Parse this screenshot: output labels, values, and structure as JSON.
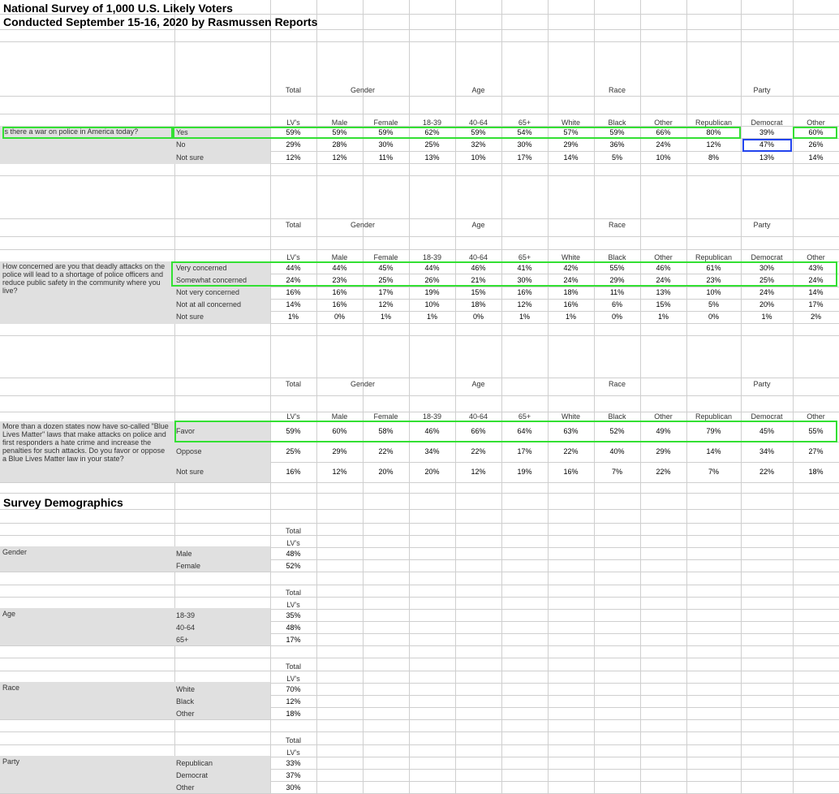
{
  "title_line1": "National Survey of 1,000 U.S. Likely Voters",
  "title_line2": "Conducted September 15-16, 2020 by Rasmussen Reports",
  "group_labels": [
    "Total",
    "Gender",
    "Age",
    "Race",
    "Party"
  ],
  "col_labels": [
    "LV's",
    "Male",
    "Female",
    "18-39",
    "40-64",
    "65+",
    "White",
    "Black",
    "Other",
    "Republican",
    "Democrat",
    "Other"
  ],
  "questions": [
    {
      "text": "Is there a war on police in America today?",
      "answers": [
        "Yes",
        "No",
        "Not sure"
      ],
      "rows": [
        [
          "59%",
          "59%",
          "59%",
          "62%",
          "59%",
          "54%",
          "57%",
          "59%",
          "66%",
          "80%",
          "39%",
          "60%"
        ],
        [
          "29%",
          "28%",
          "30%",
          "25%",
          "32%",
          "30%",
          "29%",
          "36%",
          "24%",
          "12%",
          "47%",
          "26%"
        ],
        [
          "12%",
          "12%",
          "11%",
          "13%",
          "10%",
          "17%",
          "14%",
          "5%",
          "10%",
          "8%",
          "13%",
          "14%"
        ]
      ]
    },
    {
      "text": "How concerned are you that deadly attacks on the police will lead to a shortage of police officers and reduce public safety in the community where you live?",
      "answers": [
        "Very concerned",
        "Somewhat concerned",
        "Not very concerned",
        "Not at all concerned",
        "Not sure"
      ],
      "rows": [
        [
          "44%",
          "44%",
          "45%",
          "44%",
          "46%",
          "41%",
          "42%",
          "55%",
          "46%",
          "61%",
          "30%",
          "43%"
        ],
        [
          "24%",
          "23%",
          "25%",
          "26%",
          "21%",
          "30%",
          "24%",
          "29%",
          "24%",
          "23%",
          "25%",
          "24%"
        ],
        [
          "16%",
          "16%",
          "17%",
          "19%",
          "15%",
          "16%",
          "18%",
          "11%",
          "13%",
          "10%",
          "24%",
          "14%"
        ],
        [
          "14%",
          "16%",
          "12%",
          "10%",
          "18%",
          "12%",
          "16%",
          "6%",
          "15%",
          "5%",
          "20%",
          "17%"
        ],
        [
          "1%",
          "0%",
          "1%",
          "1%",
          "0%",
          "1%",
          "1%",
          "0%",
          "1%",
          "0%",
          "1%",
          "2%"
        ]
      ]
    },
    {
      "text": "More than a dozen states now have so-called \"Blue Lives Matter\" laws that make attacks on police and first responders a hate crime and increase the penalties for such attacks. Do you favor or oppose a Blue Lives Matter law in your state?",
      "answers": [
        "Favor",
        "Oppose",
        "Not sure"
      ],
      "rows": [
        [
          "59%",
          "60%",
          "58%",
          "46%",
          "66%",
          "64%",
          "63%",
          "52%",
          "49%",
          "79%",
          "45%",
          "55%"
        ],
        [
          "25%",
          "29%",
          "22%",
          "34%",
          "22%",
          "17%",
          "22%",
          "40%",
          "29%",
          "14%",
          "34%",
          "27%"
        ],
        [
          "16%",
          "12%",
          "20%",
          "20%",
          "12%",
          "19%",
          "16%",
          "7%",
          "22%",
          "7%",
          "22%",
          "18%"
        ]
      ]
    }
  ],
  "demographics_title": "Survey Demographics",
  "demographics": [
    {
      "label": "Gender",
      "total": "Total",
      "lv": "LV's",
      "items": [
        {
          "name": "Male",
          "value": "48%"
        },
        {
          "name": "Female",
          "value": "52%"
        }
      ]
    },
    {
      "label": "Age",
      "total": "Total",
      "lv": "LV's",
      "items": [
        {
          "name": "18-39",
          "value": "35%"
        },
        {
          "name": "40-64",
          "value": "48%"
        },
        {
          "name": "65+",
          "value": "17%"
        }
      ]
    },
    {
      "label": "Race",
      "total": "Total",
      "lv": "LV's",
      "items": [
        {
          "name": "White",
          "value": "70%"
        },
        {
          "name": "Black",
          "value": "12%"
        },
        {
          "name": "Other",
          "value": "18%"
        }
      ]
    },
    {
      "label": "Party",
      "total": "Total",
      "lv": "LV's",
      "items": [
        {
          "name": "Republican",
          "value": "33%"
        },
        {
          "name": "Democrat",
          "value": "37%"
        },
        {
          "name": "Other",
          "value": "30%"
        }
      ]
    }
  ],
  "highlight_colors": {
    "green": "#33e033",
    "blue": "#2244ee"
  }
}
